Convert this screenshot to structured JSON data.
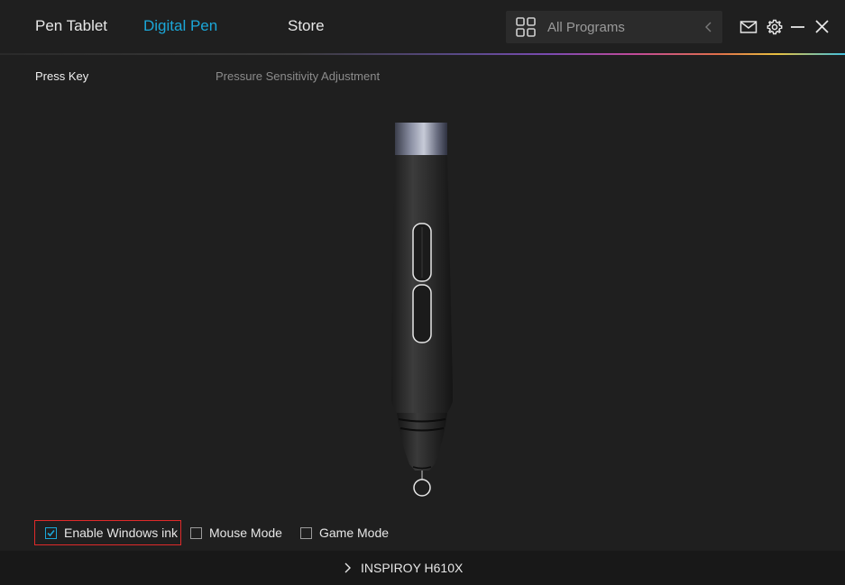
{
  "header": {
    "tabs": [
      {
        "label": "Pen Tablet",
        "active": false
      },
      {
        "label": "Digital Pen",
        "active": true
      },
      {
        "label": "Store",
        "active": false
      }
    ],
    "program_selector": {
      "label": "All Programs",
      "icon": "grid-icon"
    },
    "icons": [
      "mail-icon",
      "gear-icon",
      "minimize-icon",
      "close-icon"
    ]
  },
  "subtabs": [
    {
      "label": "Press Key",
      "active": true
    },
    {
      "label": "Pressure Sensitivity Adjustment",
      "active": false
    }
  ],
  "options": [
    {
      "label": "Enable Windows ink",
      "checked": true
    },
    {
      "label": "Mouse Mode",
      "checked": false
    },
    {
      "label": "Game Mode",
      "checked": false
    }
  ],
  "footer": {
    "device_name": "INSPIROY H610X"
  },
  "colors": {
    "background": "#1f1f1f",
    "accent": "#1ba7d8",
    "highlight_border": "#e02a2a",
    "footer_background": "#181818"
  }
}
